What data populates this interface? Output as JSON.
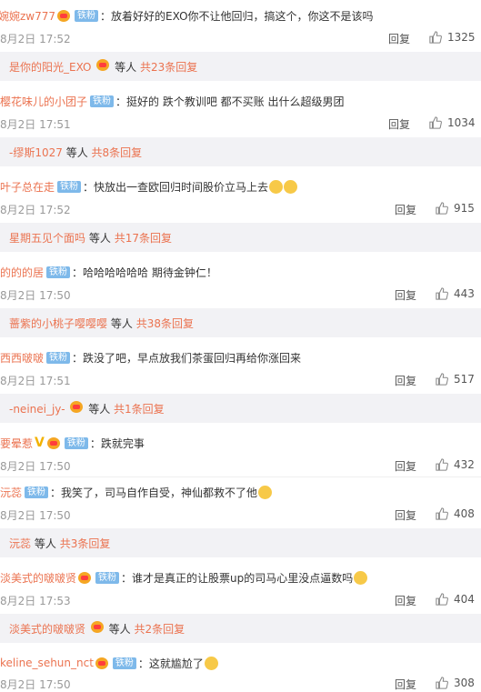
{
  "labels": {
    "reply": "回复",
    "etc": "等人",
    "fan_badge": "铁粉"
  },
  "comments": [
    {
      "user": "婉婉zw777",
      "text": "：放着好好的EXO你不让他回归，搞这个，你这不是该吗",
      "time": "8月2日 17:52",
      "likes": "1325",
      "sub_user": "是你的阳光_EXO",
      "sub_count": "共23条回复"
    },
    {
      "user": "樱花味儿的小团子",
      "text": "：挺好的 跌个教训吧  都不买账 出什么超级男团",
      "time": "8月2日 17:51",
      "likes": "1034",
      "sub_user": "-缪斯1027",
      "sub_count": "共8条回复"
    },
    {
      "user": "叶子总在走",
      "text": "：快放出一查欧回归时间股价立马上去",
      "time": "8月2日 17:52",
      "likes": "915",
      "sub_user": "星期五见个面吗",
      "sub_count": "共17条回复"
    },
    {
      "user": "的的的居",
      "text": "：哈哈哈哈哈哈 期待金钟仁！",
      "time": "8月2日 17:50",
      "likes": "443",
      "sub_user": "蔷紫的小桃子嘤嘤嘤",
      "sub_count": "共38条回复"
    },
    {
      "user": "西西啵啵",
      "text": "：跌没了吧，早点放我们茶蛋回归再给你涨回来",
      "time": "8月2日 17:51",
      "likes": "517",
      "sub_user": "-neinei_jy-",
      "sub_count": "共1条回复"
    },
    {
      "user": "要晕惹",
      "text": "：跌就完事",
      "time": "8月2日 17:50",
      "likes": "432"
    },
    {
      "user": "沅蕊",
      "text": "：我笑了，司马自作自受，神仙都救不了他",
      "time": "8月2日 17:50",
      "likes": "408",
      "sub_user": "沅蕊",
      "sub_count": "共3条回复"
    },
    {
      "user": "淡美式的啵啵贤",
      "text": "：谁才是真正的让股票up的司马心里没点逼数吗",
      "time": "8月2日 17:53",
      "likes": "404",
      "sub_user": "淡美式的啵啵贤",
      "sub_count": "共2条回复"
    },
    {
      "user": "keline_sehun_nct",
      "text": "：这就尴尬了",
      "time": "8月2日 17:50",
      "likes": "308"
    }
  ],
  "colors": {
    "username": "#eb7350",
    "fan_badge_bg": "#7eb9ea",
    "sub_bg": "#f2f2f5"
  }
}
